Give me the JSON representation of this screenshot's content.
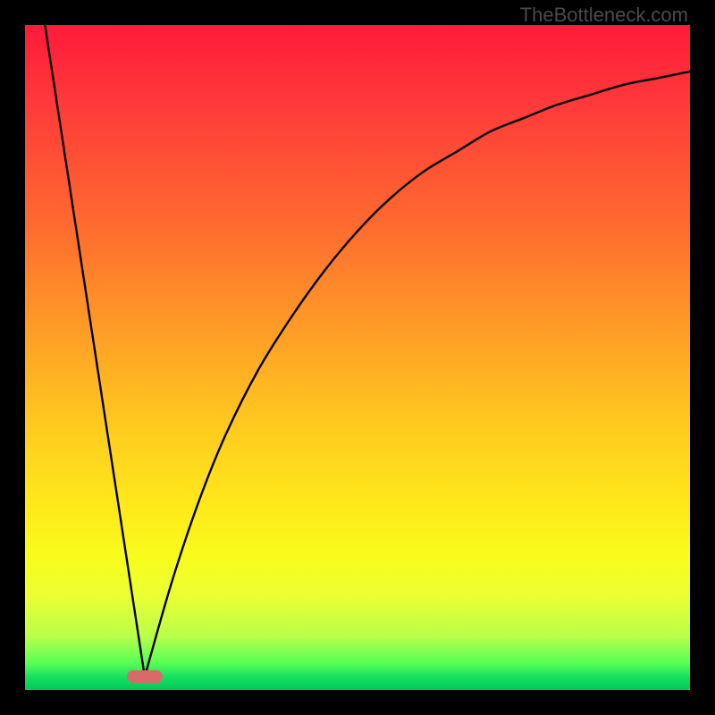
{
  "attribution": "TheBottleneck.com",
  "colors": {
    "frame": "#000000",
    "gradient_top": "#ff1a3a",
    "gradient_mid1": "#ff9a26",
    "gradient_mid2": "#ffe81a",
    "gradient_bottom": "#00c85a",
    "curve": "#000000",
    "marker": "#d86a6a"
  },
  "chart_data": {
    "type": "line",
    "title": "",
    "xlabel": "",
    "ylabel": "",
    "xlim": [
      0,
      100
    ],
    "ylim": [
      0,
      100
    ],
    "notes": "Background gradient encodes value from red (high/bad) at top to green (low/good) at bottom. Two black curves: a steep descending segment from upper-left to a minimum near x≈18, and a rising concave curve from that minimum toward upper-right. Pink pill marker sits at the minimum of the V on the x-axis.",
    "series": [
      {
        "name": "left-descent",
        "x": [
          3,
          18
        ],
        "values": [
          100,
          2
        ]
      },
      {
        "name": "right-rise",
        "x": [
          18,
          22,
          26,
          30,
          35,
          40,
          45,
          50,
          55,
          60,
          65,
          70,
          75,
          80,
          85,
          90,
          95,
          100
        ],
        "values": [
          2,
          16,
          28,
          38,
          48,
          56,
          63,
          69,
          74,
          78,
          81,
          84,
          86,
          88,
          89.5,
          91,
          92,
          93
        ]
      }
    ],
    "marker": {
      "x": 18,
      "y": 2,
      "shape": "pill"
    }
  }
}
